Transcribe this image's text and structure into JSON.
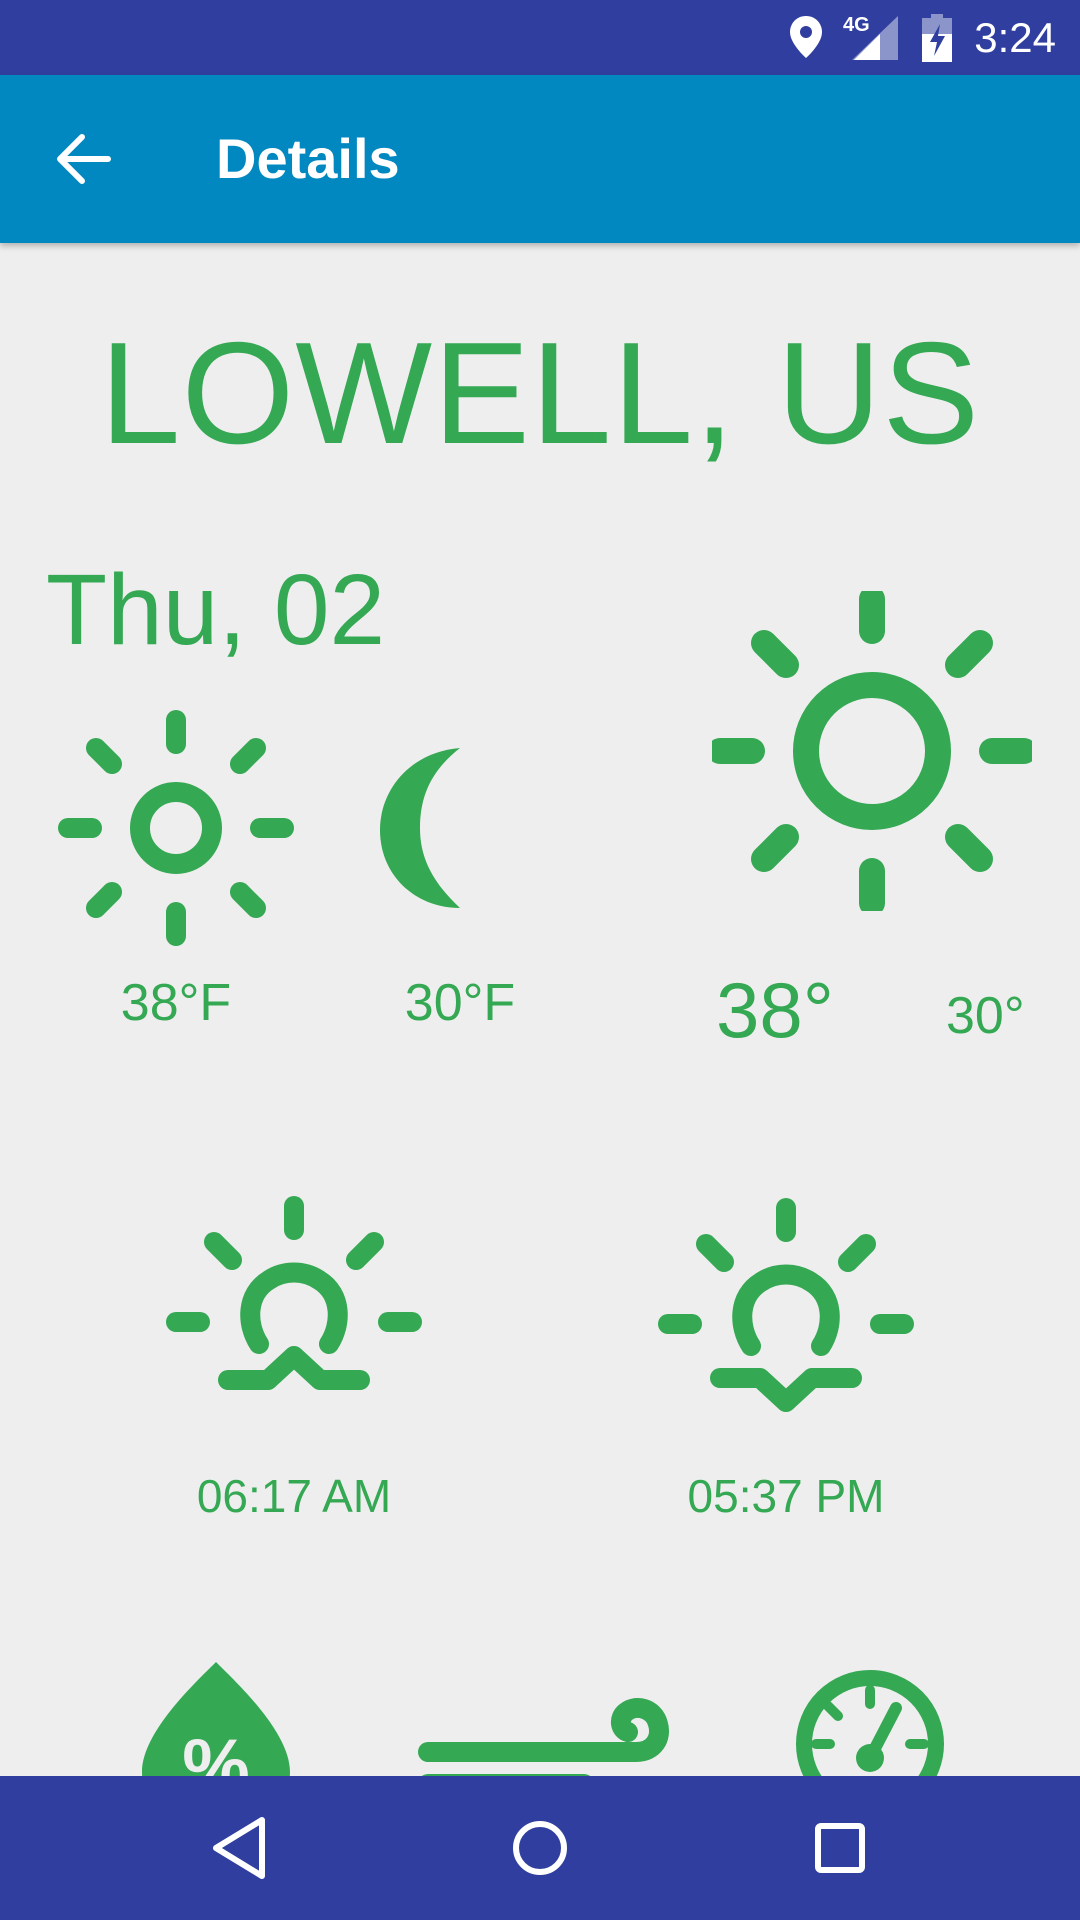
{
  "status_bar": {
    "time": "3:24",
    "network": "4G",
    "icons": [
      "location-icon",
      "signal-icon",
      "battery-charging-icon"
    ]
  },
  "app_bar": {
    "back_icon": "arrow-back-icon",
    "title": "Details"
  },
  "location": "LOWELL, US",
  "date": "Thu, 02",
  "forecast": {
    "day": {
      "icon": "sun-icon",
      "temp": "38°F"
    },
    "night": {
      "icon": "moon-icon",
      "temp": "30°F"
    },
    "current": {
      "icon": "sun-icon",
      "high": "38°",
      "low": "30°"
    }
  },
  "sun_times": {
    "sunrise": {
      "icon": "sunrise-icon",
      "time": "06:17 AM"
    },
    "sunset": {
      "icon": "sunset-icon",
      "time": "05:37 PM"
    }
  },
  "metrics_icons": [
    "humidity-icon",
    "wind-icon",
    "pressure-icon"
  ],
  "nav_bar": {
    "icons": [
      "nav-back-icon",
      "nav-home-icon",
      "nav-recents-icon"
    ]
  },
  "colors": {
    "accent_green": "#34a853",
    "app_bar": "#0288c1",
    "status_nav_bar": "#303f9f",
    "background": "#eeeeee"
  }
}
